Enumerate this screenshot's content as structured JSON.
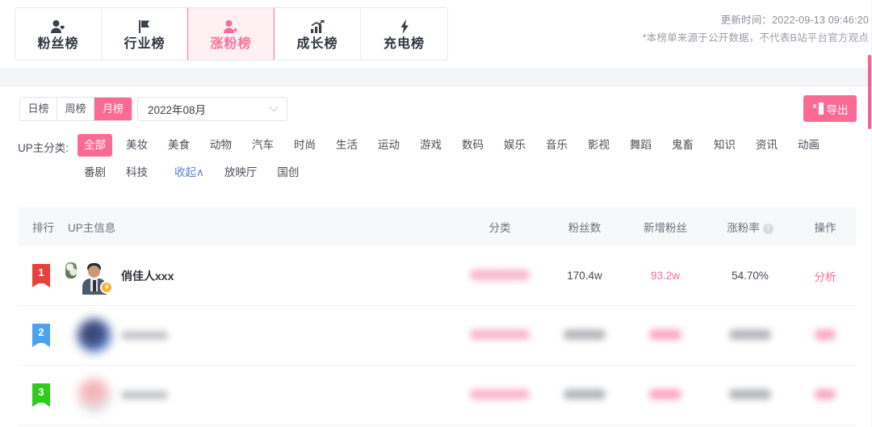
{
  "topnav": {
    "tabs": [
      {
        "label": "粉丝榜",
        "icon": "person-heart-icon",
        "active": false
      },
      {
        "label": "行业榜",
        "icon": "flag-icon",
        "active": false
      },
      {
        "label": "涨粉榜",
        "icon": "person-up-icon",
        "active": true
      },
      {
        "label": "成长榜",
        "icon": "bar-chart-arrow-icon",
        "active": false
      },
      {
        "label": "充电榜",
        "icon": "lightning-bolt-icon",
        "active": false
      }
    ],
    "update_time": "更新时间：2022-09-13 09:46:20",
    "disclaimer": "*本榜单来源于公开数据，不代表B站平台官方观点"
  },
  "filterbar": {
    "periods": [
      {
        "label": "日榜",
        "active": false
      },
      {
        "label": "周榜",
        "active": false
      },
      {
        "label": "月榜",
        "active": true
      }
    ],
    "date_value": "2022年08月",
    "date_caret_icon": "chevron-down-icon",
    "export_label": "导出",
    "export_icon": "excel-icon"
  },
  "category_filter": {
    "label": "UP主分类:",
    "items": [
      {
        "label": "全部",
        "active": true
      },
      {
        "label": "美妆",
        "active": false
      },
      {
        "label": "美食",
        "active": false
      },
      {
        "label": "动物",
        "active": false
      },
      {
        "label": "汽车",
        "active": false
      },
      {
        "label": "时尚",
        "active": false
      },
      {
        "label": "生活",
        "active": false
      },
      {
        "label": "运动",
        "active": false
      },
      {
        "label": "游戏",
        "active": false
      },
      {
        "label": "数码",
        "active": false
      },
      {
        "label": "娱乐",
        "active": false
      },
      {
        "label": "音乐",
        "active": false
      },
      {
        "label": "影视",
        "active": false
      },
      {
        "label": "舞蹈",
        "active": false
      },
      {
        "label": "鬼畜",
        "active": false
      },
      {
        "label": "知识",
        "active": false
      },
      {
        "label": "资讯",
        "active": false
      },
      {
        "label": "动画",
        "active": false
      },
      {
        "label": "番剧",
        "active": false
      },
      {
        "label": "科技",
        "active": false
      },
      {
        "label": "放映厅",
        "active": false
      },
      {
        "label": "国创",
        "active": false
      }
    ],
    "collapse_label": "收起∧"
  },
  "table": {
    "headers": {
      "rank": "排行",
      "upinfo": "UP主信息",
      "category": "分类",
      "fans": "粉丝数",
      "new_fans": "新增粉丝",
      "growth_rate": "涨粉率",
      "growth_rate_help_icon": "question-mark-icon",
      "action": "操作"
    },
    "rows": [
      {
        "rank": "1",
        "rank_color": "#e8413c",
        "name": "俏佳人xxx",
        "blurred": false,
        "category": "",
        "fans": "170.4w",
        "new_fans": "93.2w",
        "growth_rate": "54.70%",
        "action": "分析",
        "badge_icon": "lightning-level-icon"
      },
      {
        "rank": "2",
        "rank_color": "#4aa3f0",
        "name": "",
        "blurred": true,
        "category": "",
        "fans": "",
        "new_fans": "",
        "growth_rate": "",
        "action": ""
      },
      {
        "rank": "3",
        "rank_color": "#2ecc1e",
        "name": "",
        "blurred": true,
        "category": "",
        "fans": "",
        "new_fans": "",
        "growth_rate": "",
        "action": ""
      }
    ]
  },
  "colors": {
    "accent_pink": "#fb6a95",
    "active_tab_bg": "#fff0f4",
    "link_blue": "#5a7fd6",
    "header_bg": "#f7f8fa"
  }
}
